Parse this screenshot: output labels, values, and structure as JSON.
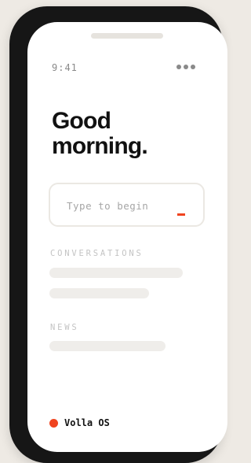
{
  "status_bar": {
    "time": "9:41",
    "menu_icon": "more-dots-icon"
  },
  "greeting": "Good morning.",
  "input": {
    "placeholder": "Type to begin",
    "cursor": "_"
  },
  "sections": {
    "conversations": {
      "label": "CONVERSATIONS",
      "placeholder_rows": 2
    },
    "news": {
      "label": "NEWS",
      "placeholder_rows": 1
    }
  },
  "brand": {
    "name": "Volla OS"
  },
  "colors": {
    "accent": "#f0441f",
    "frame": "#161616",
    "skeleton": "#efedea",
    "background": "#eeeae4"
  }
}
